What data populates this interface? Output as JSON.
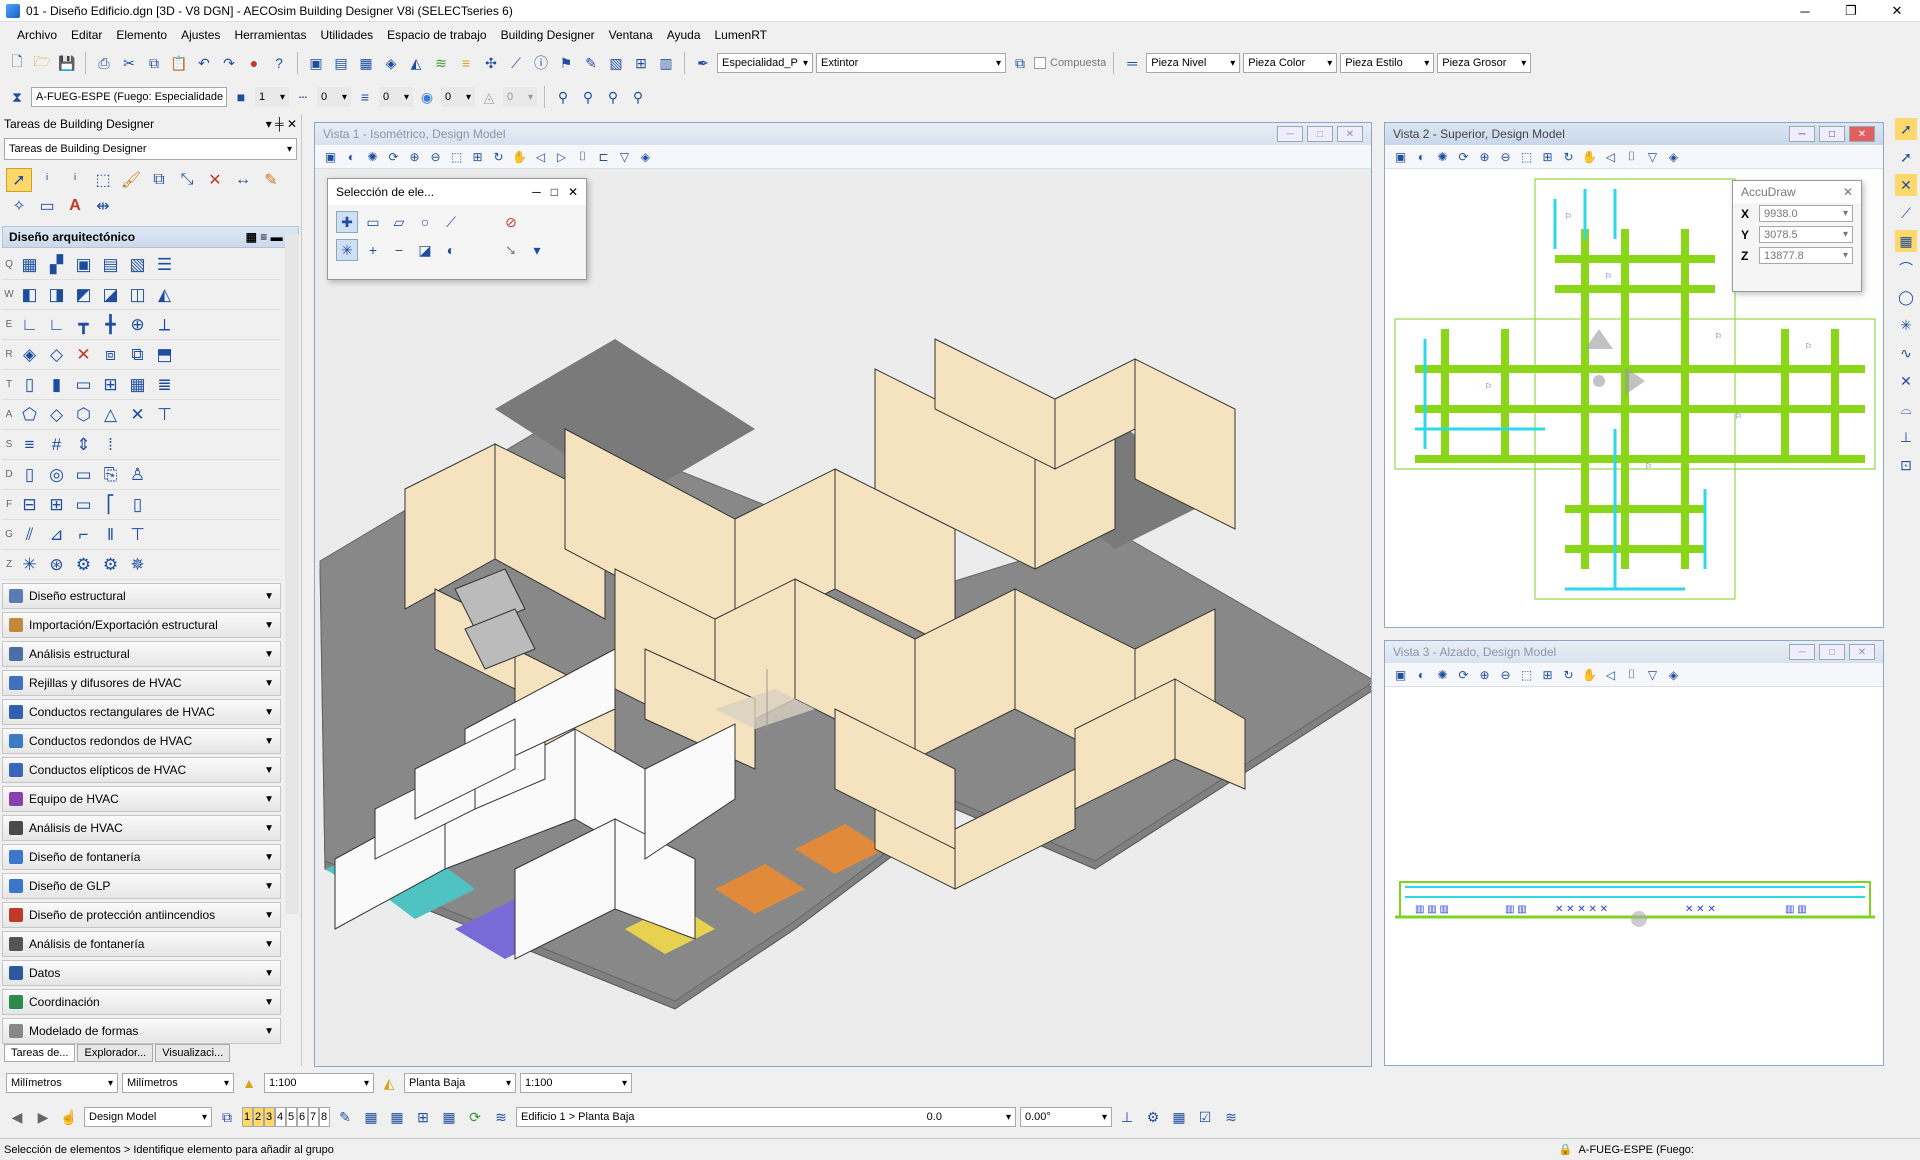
{
  "window": {
    "title": "01 - Diseño Edificio.dgn [3D - V8 DGN] - AECOsim Building Designer V8i (SELECTseries 6)"
  },
  "menu": [
    "Archivo",
    "Editar",
    "Elemento",
    "Ajustes",
    "Herramientas",
    "Utilidades",
    "Espacio de trabajo",
    "Building Designer",
    "Ventana",
    "Ayuda",
    "LumenRT"
  ],
  "toolbar1": {
    "especialidad": "Especialidad_P",
    "tipo": "Extintor",
    "compuesta": "Compuesta",
    "pieza_nivel": "Pieza Nivel",
    "pieza_color": "Pieza Color",
    "pieza_estilo": "Pieza Estilo",
    "pieza_grosor": "Pieza Grosor"
  },
  "toolbar2": {
    "nivel": "A-FUEG-ESPE (Fuego: Especialidade",
    "color": "1",
    "estilo": "0",
    "grosor": "0",
    "transp": "0",
    "prior": "0"
  },
  "leftpanel": {
    "title": "Tareas de Building Designer",
    "combo": "Tareas de Building Designer",
    "section_open": "Diseño arquitectónico",
    "row_letters": [
      "Q",
      "W",
      "E",
      "R",
      "T",
      "A",
      "S",
      "D",
      "F",
      "G",
      "Z"
    ],
    "categories": [
      {
        "label": "Diseño estructural",
        "color": "#5a7bb5"
      },
      {
        "label": "Importación/Exportación estructural",
        "color": "#c08a3a"
      },
      {
        "label": "Análisis estructural",
        "color": "#4a6fa5"
      },
      {
        "label": "Rejillas y difusores de HVAC",
        "color": "#4070c0"
      },
      {
        "label": "Conductos rectangulares de HVAC",
        "color": "#3060b0"
      },
      {
        "label": "Conductos redondos de HVAC",
        "color": "#3d7ac4"
      },
      {
        "label": "Conductos elípticos de HVAC",
        "color": "#3768b8"
      },
      {
        "label": "Equipo de HVAC",
        "color": "#8a3fb0"
      },
      {
        "label": "Análisis de HVAC",
        "color": "#4a4a4a"
      },
      {
        "label": "Diseño de fontanería",
        "color": "#3b78c9"
      },
      {
        "label": "Diseño de GLP",
        "color": "#3b78c9"
      },
      {
        "label": "Diseño de protección antiincendios",
        "color": "#c0392b"
      },
      {
        "label": "Análisis de fontanería",
        "color": "#555555"
      },
      {
        "label": "Datos",
        "color": "#2c5aa0"
      },
      {
        "label": "Coordinación",
        "color": "#2c8a4a"
      },
      {
        "label": "Modelado de formas",
        "color": "#888888"
      }
    ],
    "tabs": [
      "Tareas de...",
      "Explorador...",
      "Visualizaci..."
    ]
  },
  "views": {
    "v1": "Vista 1 - Isométrico, Design Model",
    "v2": "Vista 2 - Superior, Design Model",
    "v3": "Vista 3 - Alzado, Design Model"
  },
  "selection_dialog": {
    "title": "Selección de ele..."
  },
  "accudraw": {
    "title": "AccuDraw",
    "x_label": "X",
    "y_label": "Y",
    "z_label": "Z",
    "x": "9938.0",
    "y": "3078.5",
    "z": "13877.8"
  },
  "bottom1": {
    "unit1": "Milímetros",
    "unit2": "Milímetros",
    "scale1": "1:100",
    "level": "Planta Baja",
    "scale2": "1:100"
  },
  "bottom2": {
    "model": "Design Model",
    "views": [
      "1",
      "2",
      "3",
      "4",
      "5",
      "6",
      "7",
      "8"
    ],
    "path": "Edificio 1 > Planta Baja",
    "val": "0.0",
    "angle": "0.00°"
  },
  "status": {
    "msg": "Selección de elementos > Identifique elemento para añadir al grupo",
    "level": "A-FUEG-ESPE (Fuego:"
  }
}
